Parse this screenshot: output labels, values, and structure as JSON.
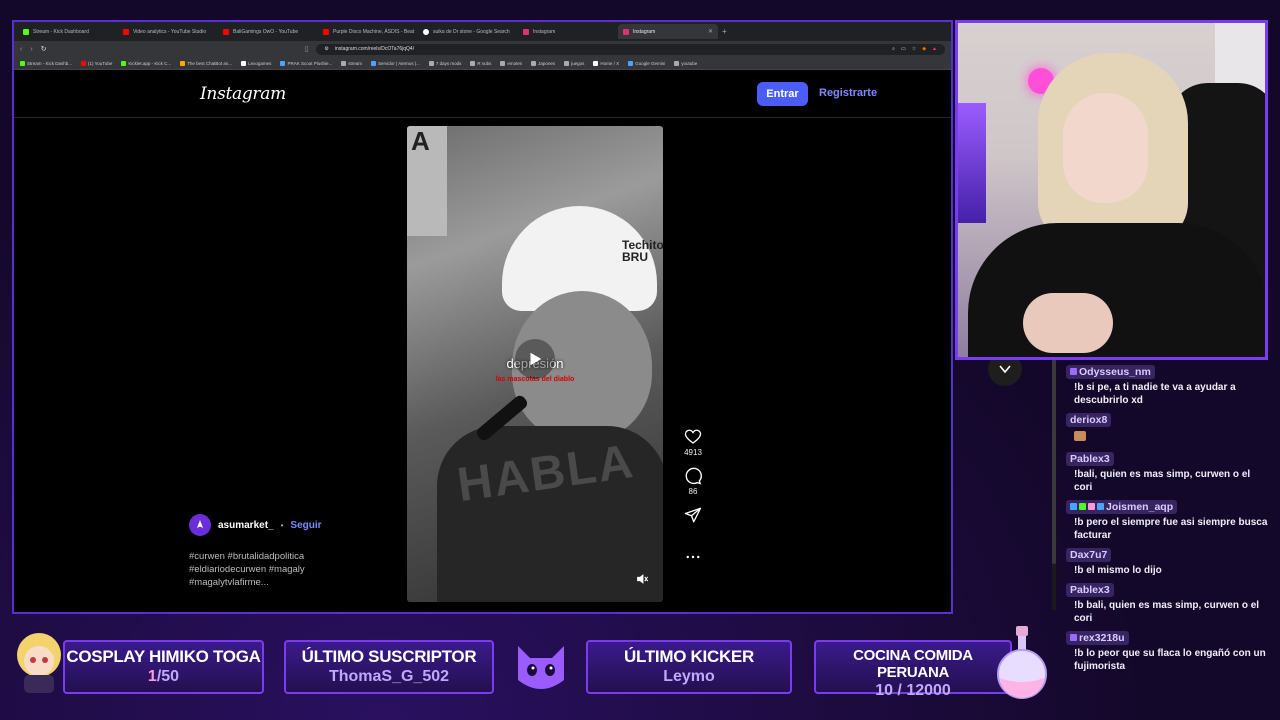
{
  "browser": {
    "tabs": [
      {
        "label": "Stream - Kick Dashboard",
        "color": "#53fc18"
      },
      {
        "label": "Video analytics - YouTube Studio",
        "color": "#ff0000"
      },
      {
        "label": "BaliGamings OwO - YouTube",
        "color": "#ff0000"
      },
      {
        "label": "Purple Disco Machine, ÁSDIS - Beat",
        "color": "#ff0000"
      },
      {
        "label": "suika de Dr stone - Google Search",
        "color": "#ffffff"
      },
      {
        "label": "Instagram",
        "color": "#e1306c"
      },
      {
        "label": "Instagram",
        "color": "#e1306c"
      }
    ],
    "url": "instagram.com/reels/DcOTa76jqQ4/",
    "bookmarks": [
      "Stream - Kick Dashb...",
      "(1) YouTube",
      "Kicklet.app - Kick C...",
      "The best ChatBot an...",
      "Lexogames",
      "PRAK Scout Plushie...",
      "stream",
      "Servidor | Aternos |...",
      "7 days mods",
      "R subs",
      "emotes",
      "Japones",
      "juegos",
      "Home / X",
      "Google Gemini",
      "youtube"
    ]
  },
  "instagram": {
    "logo": "Instagram",
    "login_label": "Entrar",
    "signup_label": "Registrarte",
    "video": {
      "helmet_text": "Techito BRU",
      "shirt_text": "HABLA",
      "sign_text": "A",
      "caption_main": "depresión",
      "caption_sub": "las mascotas del diablo"
    },
    "likes": "4913",
    "comments": "86",
    "username": "asumarket_",
    "separator": "•",
    "follow_label": "Seguir",
    "hashtags": [
      "#curwen #brutalidadpolitica",
      "#eldiariodecurwen #magaly",
      "#magalytvlafirme..."
    ]
  },
  "chat": [
    {
      "user": "Odysseus_nm",
      "text": "!b si pe, a ti nadie te va a ayudar a descubrirlo xd",
      "badges": [
        "#9b6bff"
      ]
    },
    {
      "user": "deriox8",
      "text": "",
      "emote": true,
      "badges": []
    },
    {
      "user": "Pablex3",
      "text": "!bali, quien es mas simp, curwen o el cori",
      "badges": []
    },
    {
      "user": "Joismen_aqp",
      "text": "!b pero el siempre fue asi siempre busca facturar",
      "badges": [
        "#4aa3ff",
        "#53fc18",
        "#ff9ad8",
        "#4aa3ff"
      ]
    },
    {
      "user": "Dax7u7",
      "text": "!b el mismo lo dijo",
      "badges": []
    },
    {
      "user": "Pablex3",
      "text": "!b bali, quien es mas simp, curwen o el cori",
      "badges": []
    },
    {
      "user": "rex3218u",
      "text": "!b lo peor que su flaca lo engañó con un fujimorista",
      "badges": [
        "#9b6bff"
      ]
    }
  ],
  "overlay": {
    "goal": {
      "title": "COSPLAY HIMIKO TOGA",
      "current": "1",
      "total": "/50"
    },
    "subscriber": {
      "title": "ÚLTIMO SUSCRIPTOR",
      "value": "ThomaS_G_502"
    },
    "kicker": {
      "title": "ÚLTIMO KICKER",
      "value": "Leymo"
    },
    "cooking": {
      "title": "COCINA COMIDA PERUANA",
      "value": "10 / 12000"
    }
  },
  "colors": {
    "accent": "#7a3cf0",
    "ig_blue": "#4a5df9",
    "ig_link": "#7c8cff"
  }
}
